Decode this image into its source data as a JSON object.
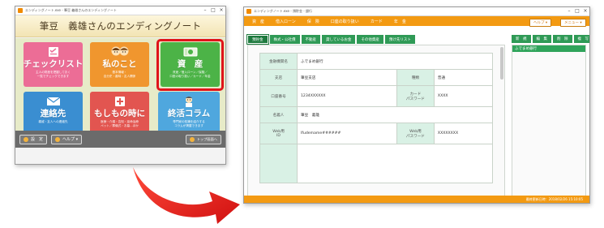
{
  "left_window": {
    "title": "エンディングノート.exe - 筆豆 義雄さんのエンディングノート",
    "header": "筆豆　義雄さんのエンディングノート",
    "tiles": [
      {
        "title": "チェックリスト",
        "sub": "主人の財産を把握しておく\n一覧でチェックできます",
        "icon": "checklist-icon"
      },
      {
        "title": "私のこと",
        "sub": "基本情報・\n自分史・趣味・友人関係",
        "icon": "family-icon"
      },
      {
        "title": "資　産",
        "sub": "資産／借入ローン／保険／\n口座の取り扱い／カード／年金",
        "icon": "money-icon"
      },
      {
        "title": "連絡先",
        "sub": "親戚・友人への連絡先",
        "icon": "mail-icon"
      },
      {
        "title": "もしもの時に",
        "sub": "医療・介護・告知・延命治療\nペット／葬儀式・お墓…ほか",
        "icon": "hospital-icon"
      },
      {
        "title": "終活コラム",
        "sub": "専門家の知識を紹介する\nコラムが掲載できます",
        "icon": "doctor-icon"
      }
    ],
    "footer": {
      "settings": "設　定",
      "help": "ヘルプ ▾",
      "top": "トップ画面へ"
    }
  },
  "right_window": {
    "title": "エンディングノート.exe - 預貯金 - 銀行",
    "menu": [
      "資　産",
      "借入ローン",
      "保　険",
      "口座の取り扱い",
      "カード",
      "年　金"
    ],
    "help_button": "ヘルプ ▾",
    "menu_button": "メニュー ▾",
    "tabs": [
      "預貯金",
      "株式・公社債",
      "不動産",
      "貸しているお金",
      "その他資産",
      "預け先リスト"
    ],
    "side_buttons": [
      "新　規",
      "編　集",
      "削　除",
      "複　写"
    ],
    "side_list": [
      "ふでまめ銀行"
    ],
    "form": {
      "bank_label": "金融機関名",
      "bank_value": "ふでまめ銀行",
      "branch_label": "支店",
      "branch_value": "筆豆支店",
      "type_label": "種類",
      "type_value": "普通",
      "account_label": "口座番号",
      "account_value": "1234XXXXXX",
      "card_pw_label": "カード\nパスワード",
      "card_pw_value": "XXXX",
      "holder_label": "名義人",
      "holder_value": "筆豆　義雄",
      "web_id_label": "Web用\nID",
      "web_id_value": "Ifudemame######",
      "web_pw_label": "Web用\nパスワード",
      "web_pw_value": "XXXXXXXX"
    },
    "status": "最終更新日時：2018/02/26 15:10:05"
  },
  "colors": {
    "orange": "#f39a12",
    "green": "#2f9a56",
    "highlight_red": "#e0141b",
    "arrow_red": "#e02020"
  }
}
